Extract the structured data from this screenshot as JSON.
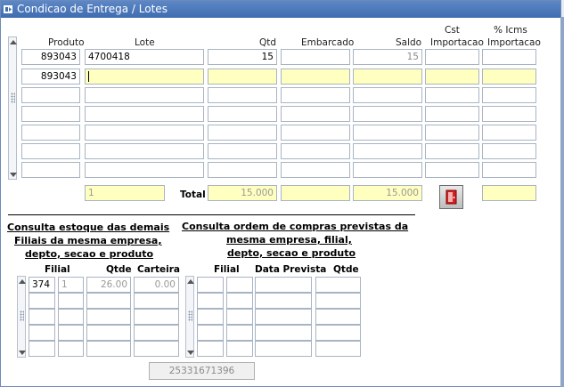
{
  "window": {
    "title": "Condicao de Entrega / Lotes"
  },
  "headers": {
    "produto": "Produto",
    "lote": "Lote",
    "qtd": "Qtd",
    "embarcado": "Embarcado",
    "saldo": "Saldo",
    "cst_line1": "Cst",
    "cst_line2": "Importacao",
    "icms_line1": "% Icms",
    "icms_line2": "Importacao"
  },
  "rows": [
    {
      "produto": "893043",
      "lote": "4700418",
      "qtd": "15",
      "embarcado": "",
      "saldo": "15",
      "cst": "",
      "icms": ""
    },
    {
      "produto": "893043",
      "lote": "",
      "qtd": "",
      "embarcado": "",
      "saldo": "",
      "cst": "",
      "icms": ""
    }
  ],
  "totals": {
    "row_indicator": "1",
    "label": "Total",
    "qtd_total": "15.000",
    "saldo_total": "15.000"
  },
  "stock_section": {
    "title_line1": "Consulta estoque das demais",
    "title_line2": "Filiais da mesma empresa,",
    "title_line3": "depto, secao e produto",
    "headers": {
      "filial": "Filial",
      "qtde": "Qtde",
      "carteira": "Carteira"
    },
    "rows": [
      {
        "filial": "374",
        "code": "1",
        "qtde": "26.00",
        "carteira": "0.00"
      }
    ]
  },
  "purchase_section": {
    "title_line1": "Consulta ordem de compras previstas da",
    "title_line2": "mesma empresa, filial,",
    "title_line3": "depto, secao e produto",
    "headers": {
      "filial": "Filial",
      "data_prevista": "Data Prevista",
      "qtde": "Qtde"
    }
  },
  "footer": {
    "code": "25331671396"
  },
  "colors": {
    "title_bg": "#4a78bb",
    "highlight": "#ffffc0",
    "exit_icon": "#d42020"
  }
}
